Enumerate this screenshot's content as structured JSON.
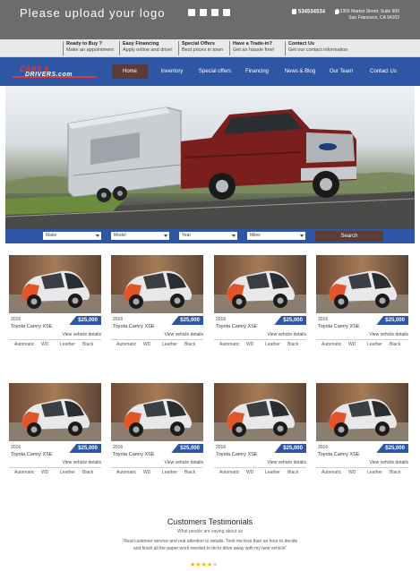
{
  "header": {
    "logo_text": "Please upload your logo",
    "social_icons": [
      "facebook-icon",
      "twitter-icon",
      "instagram-icon",
      "youtube-icon"
    ],
    "phone": "534534534",
    "address": "1355 Market Street, Suite 900 San Francisco, CA 94103"
  },
  "info_bar": [
    {
      "title": "Ready to Buy ?",
      "subtitle": "Make an appointment"
    },
    {
      "title": "Easy Financing",
      "subtitle": "Apply online and drive!"
    },
    {
      "title": "Special Offers",
      "subtitle": "Best prices in town"
    },
    {
      "title": "Have a Trade-in?",
      "subtitle": "Get an hassle free!"
    },
    {
      "title": "Contact Us",
      "subtitle": "Get our contact information"
    }
  ],
  "brand": {
    "line1": "CARS 4",
    "line2": "DRIVERS.com"
  },
  "nav": {
    "items": [
      "Home",
      "Inventory",
      "Special offers",
      "Financing",
      "News & Blog",
      "Our Team",
      "Contact Us"
    ],
    "active": "Home"
  },
  "search": {
    "make": "Make",
    "model": "Model",
    "year": "Year",
    "miles": "Miles",
    "button": "Search"
  },
  "listings": [
    {
      "year": "2016",
      "title": "Toyota Camry XSE",
      "price": "$25,000",
      "view": "View vehicle details",
      "transmission": "Automatic",
      "drive": "WD",
      "interior": "Leather",
      "color": "Black"
    },
    {
      "year": "2016",
      "title": "Toyota Camry XSE",
      "price": "$25,000",
      "view": "View vehicle details",
      "transmission": "Automatic",
      "drive": "WD",
      "interior": "Leather",
      "color": "Black"
    },
    {
      "year": "2016",
      "title": "Toyota Camry XSE",
      "price": "$25,000",
      "view": "View vehicle details",
      "transmission": "Automatic",
      "drive": "WD",
      "interior": "Leather",
      "color": "Black"
    },
    {
      "year": "2016",
      "title": "Toyota Camry XSE",
      "price": "$25,000",
      "view": "View vehicle details",
      "transmission": "Automatic",
      "drive": "WD",
      "interior": "Leather",
      "color": "Black"
    },
    {
      "year": "2016",
      "title": "Toyota Camry XSE",
      "price": "$25,000",
      "view": "View vehicle details",
      "transmission": "Automatic",
      "drive": "WD",
      "interior": "Leather",
      "color": "Black"
    },
    {
      "year": "2016",
      "title": "Toyota Camry XSE",
      "price": "$25,000",
      "view": "View vehicle details",
      "transmission": "Automatic",
      "drive": "WD",
      "interior": "Leather",
      "color": "Black"
    },
    {
      "year": "2016",
      "title": "Toyota Camry XSE",
      "price": "$25,000",
      "view": "View vehicle details",
      "transmission": "Automatic",
      "drive": "WD",
      "interior": "Leather",
      "color": "Black"
    },
    {
      "year": "2016",
      "title": "Toyota Camry XSE",
      "price": "$25,000",
      "view": "View vehicle details",
      "transmission": "Automatic",
      "drive": "WD",
      "interior": "Leather",
      "color": "Black"
    }
  ],
  "testimonials": {
    "title": "Customers Testimonials",
    "subtitle": "What people are saying about us",
    "quote": "\"Real customer service and real attention to details. Took me less than an hour to decide and finish all the paper work needed to do to drive away with my new vehicle\"",
    "rating": 4,
    "rating_max": 5
  },
  "colors": {
    "brand_blue": "#2d56a5",
    "active_brown": "#5a3d38",
    "top_gray": "#6c6c6c",
    "star_gold": "#f0b400"
  }
}
